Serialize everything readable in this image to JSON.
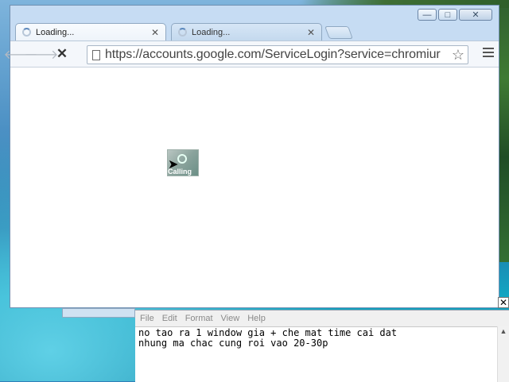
{
  "browser": {
    "tabs": [
      {
        "title": "Loading..."
      },
      {
        "title": "Loading..."
      }
    ],
    "url": "https://accounts.google.com/ServiceLogin?service=chromiur",
    "ghost_label": "Calling"
  },
  "icons": {
    "back": "arrow-left",
    "forward": "arrow-right",
    "stop": "x",
    "star": "star",
    "menu": "hamburger",
    "close": "x"
  },
  "notepad": {
    "menu": [
      "File",
      "Edit",
      "Format",
      "View",
      "Help"
    ],
    "lines": [
      "no tao ra 1 window gia + che mat time cai dat",
      "nhung ma chac cung roi vao 20-30p"
    ]
  }
}
